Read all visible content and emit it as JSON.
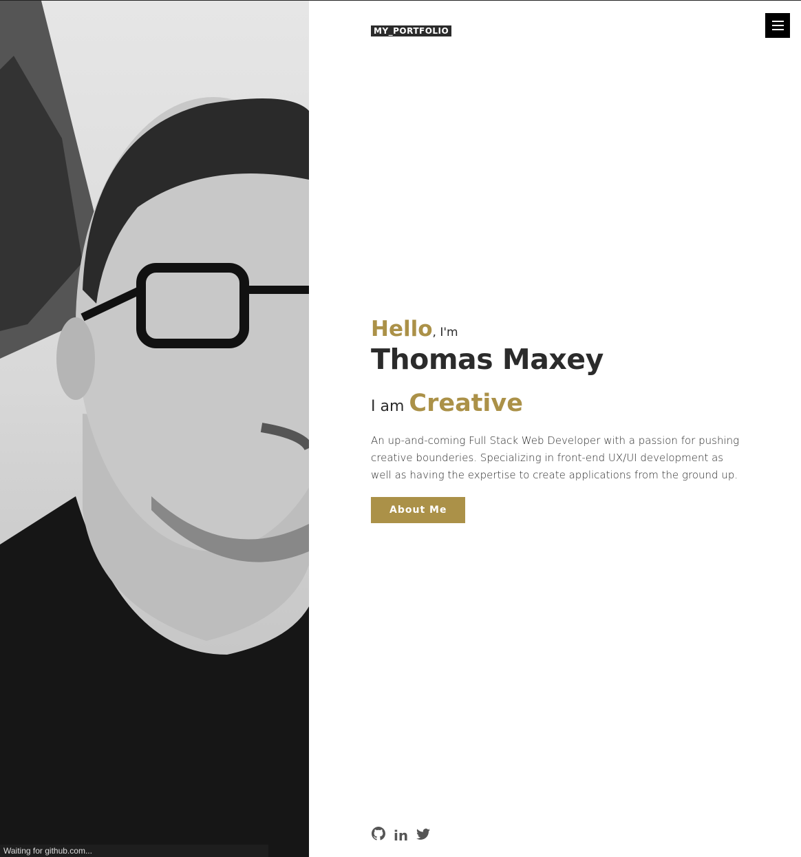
{
  "header": {
    "logo": "MY_PORTFOLIO",
    "menu_icon": "hamburger-icon"
  },
  "hero": {
    "hello": "Hello",
    "im": ", I'm",
    "name": "Thomas Maxey",
    "i_am": "I am ",
    "role": "Creative",
    "description": "An up-and-coming Full Stack Web Developer with a passion for pushing creative bounderies. Specializing in front-end UX/UI development as well as having the expertise to create applications from the ground up.",
    "button": "About Me"
  },
  "social": {
    "github_icon": "github-icon",
    "linkedin": "in",
    "twitter_icon": "twitter-icon"
  },
  "status_bar": "Waiting for github.com...",
  "colors": {
    "accent": "#ab9148",
    "text": "#2b2b2b"
  }
}
